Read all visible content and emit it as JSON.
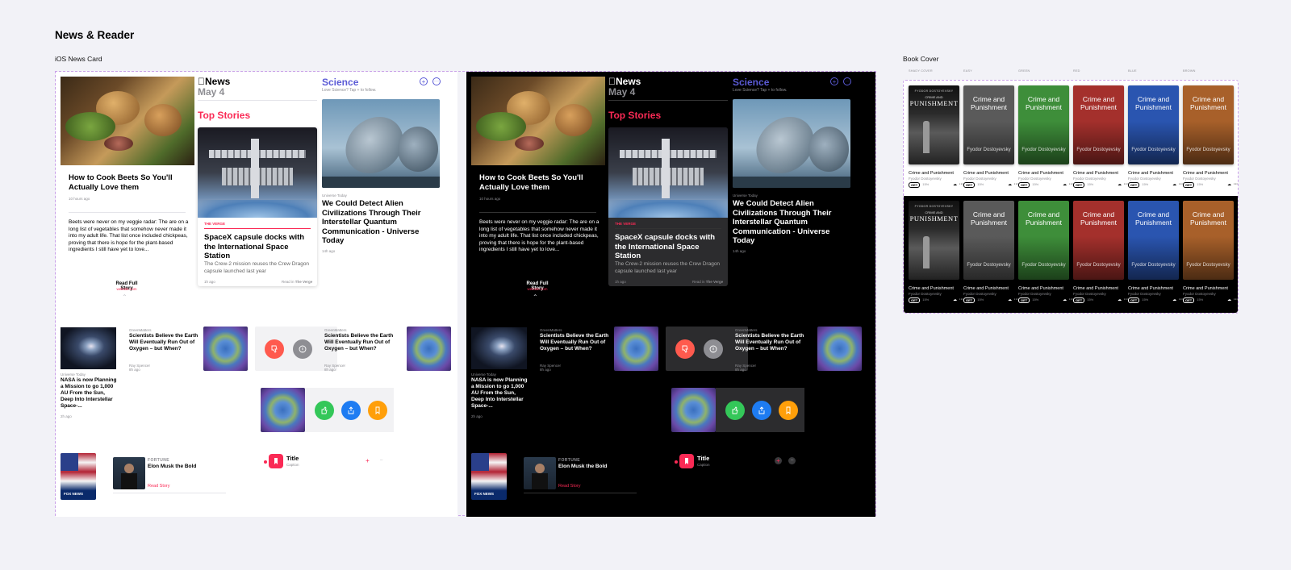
{
  "page": {
    "title": "News & Reader",
    "news_section": "iOS News Card",
    "book_section": "Book Cover"
  },
  "news": {
    "recipe": {
      "title": "How to Cook Beets So You'll Actually Love them",
      "time": "10 hours ago",
      "body": "Beets were never on my veggie radar: The are on a long list of vegetables that somehow never made it into my adult life. That list once included chickpeas, proving that there is hope for the plant-based ingredients I still have yet to love...",
      "read_full": "Read Full Story",
      "site": "website.com"
    },
    "header": {
      "brand": "News",
      "date": "May 4"
    },
    "top_stories": {
      "label": "Top Stories",
      "source": "THE VERGE",
      "title": "SpaceX capsule docks with the International Space Station",
      "summary": "The Crew-2 mission reuses the Crew Dragon capsule launched last year",
      "time": "1h ago",
      "read_in": "Read in",
      "read_in_source": "The Verge"
    },
    "science": {
      "label": "Science",
      "sub": "Love Science? Tap + to follow.",
      "source": "Universe Today",
      "title": "We Could Detect Alien Civilizations Through Their Interstellar Quantum Communication - Universe Today",
      "time": "14h ago"
    },
    "nasa": {
      "source": "Universe Today",
      "title": "NASA is now Planning a Mission to go 1,000 AU From the Sun, Deep Into Interstellar Space-...",
      "time": "2h ago"
    },
    "oxygen": {
      "source": "GreenMatters",
      "title": "Scientists Believe the Earth Will Eventually Run Out of Oxygen – but When?",
      "author": "Ray Spencer",
      "time": "8h ago"
    },
    "oxygen2": {
      "source": "GreenMatters",
      "title": "Scientists Believe the Earth Will Eventually Run Out of Oxygen – but When?",
      "author": "Ray Spencer",
      "time": "8h ago"
    },
    "fox": {
      "label": "FOX NEWS"
    },
    "fortune": {
      "source": "FORTUNE",
      "title": "Elon Musk the Bold",
      "link": "Read Story"
    },
    "list": {
      "title": "Title",
      "caption": "Caption"
    }
  },
  "books": {
    "columns": [
      "SHADY COVER",
      "EASY",
      "GREEN",
      "RED",
      "BLUE",
      "BROWN"
    ],
    "cover_title": "Crime and Punishment",
    "cover_author": "Fyodor Dostoyevsky",
    "photo_author": "FYODOR DOSTOYEVSKY",
    "photo_title": "PUNISHMENT",
    "photo_top": "CRIME AND",
    "get": "GET",
    "pct": "15%",
    "colors": [
      "#2b2b2b",
      "#5a5a5a",
      "#3e8e3a",
      "#a4302c",
      "#2a55b0",
      "#a8602a"
    ]
  },
  "colors": {
    "red": "#fa2a55",
    "purple": "#5b5bd6",
    "green": "#34c759",
    "blue": "#1e7cf2",
    "orange": "#ff9f0a"
  }
}
